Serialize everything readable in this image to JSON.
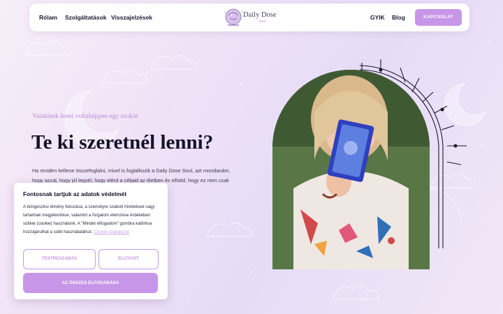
{
  "nav": {
    "left_links": [
      "Rólam",
      "Szolgáltatások",
      "Visszajelzések"
    ],
    "right_links": [
      "GYIK",
      "Blog"
    ],
    "cta_label": "KAPCSOLAT",
    "logo_title": "Daily Dose",
    "logo_sub": "Soul"
  },
  "hero": {
    "eyebrow": "Valakinek lenni voltaképpen egy szokás",
    "headline": "Te ki szeretnél lenni?",
    "body": "Ha röviden kellene összefoglalni, mivel is foglalkozik a Daily Dose Soul, azt mondanám, hogy azzal, hogy jól legyél, hogy elérd a céljaid az életben és elhidd, hogy ez nem csak"
  },
  "cookie": {
    "title": "Fontosnak tartjuk az adatok védelmét",
    "text": "A böngészési élmény fokozása, a személyre szabott hirdetések vagy tartalmak megjelenítése, valamint a forgalom elemzése érdekében sütiket (cookie) használunk. A \"Mindet elfogadom\" gombra kattintva hozzájárulhat a sütik használatához.",
    "policy_link": "Cookie-szabályzat",
    "customize_label": "TESTRESZABÁS",
    "reject_label": "ELUTASÍT",
    "accept_all_label": "AZ ÖSSZES ELFOGADÁSA"
  },
  "colors": {
    "accent": "#c796e8",
    "heading": "#14122a",
    "eyebrow": "#b98ad6"
  }
}
